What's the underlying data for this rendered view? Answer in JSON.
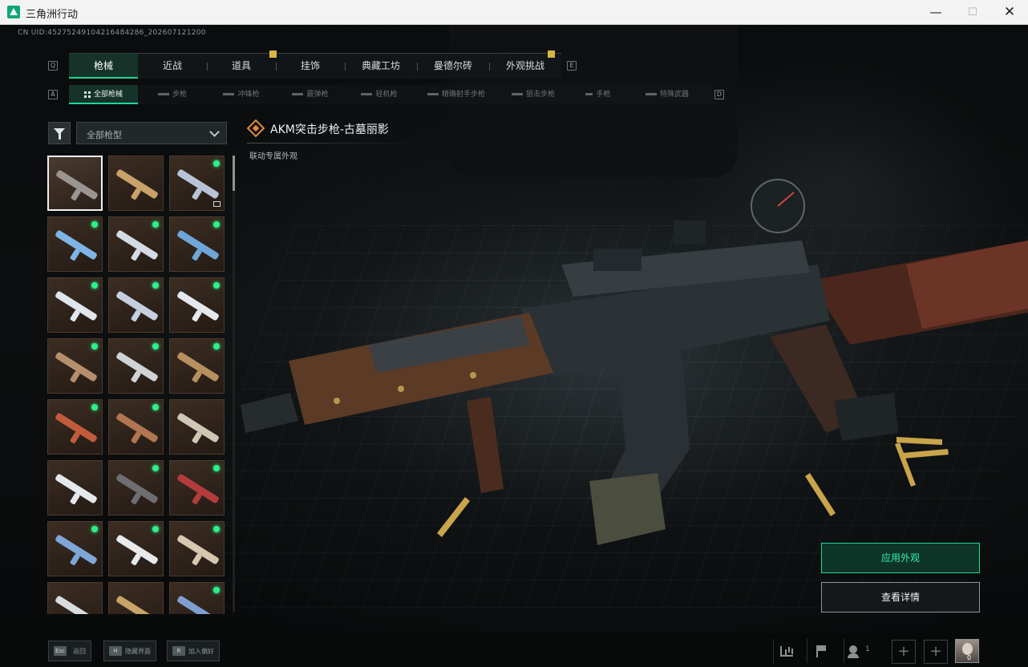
{
  "window": {
    "title": "三角洲行动"
  },
  "uid": "CN UID:452752491042164842­86_202607121200",
  "tabs": [
    {
      "label": "枪械",
      "active": true
    },
    {
      "label": "近战",
      "active": false
    },
    {
      "label": "道具",
      "active": false
    },
    {
      "label": "挂饰",
      "active": false
    },
    {
      "label": "典藏工坊",
      "active": false
    },
    {
      "label": "曼德尔砖",
      "active": false
    },
    {
      "label": "外观挑战",
      "active": false
    }
  ],
  "tab_keys": {
    "left": "Q",
    "right": "E"
  },
  "sub_tabs": [
    {
      "label": "全部枪械",
      "active": true
    },
    {
      "label": "步枪",
      "active": false
    },
    {
      "label": "冲锋枪",
      "active": false
    },
    {
      "label": "霰弹枪",
      "active": false
    },
    {
      "label": "轻机枪",
      "active": false
    },
    {
      "label": "精确射手步枪",
      "active": false
    },
    {
      "label": "狙击步枪",
      "active": false
    },
    {
      "label": "手枪",
      "active": false
    },
    {
      "label": "特殊武器",
      "active": false
    }
  ],
  "sub_keys": {
    "left": "A",
    "right": "D"
  },
  "filter": {
    "selected": "全部枪型"
  },
  "skins": [
    {
      "new": false,
      "selected": true,
      "tone": "#9a9590"
    },
    {
      "new": false,
      "tone": "#c9a26a"
    },
    {
      "new": true,
      "tone": "#b8c4d6",
      "mini_icon": true
    },
    {
      "new": true,
      "tone": "#7fb4e6"
    },
    {
      "new": true,
      "tone": "#d4dbe4"
    },
    {
      "new": true,
      "tone": "#6fa6d6"
    },
    {
      "new": true,
      "tone": "#dfe6ee"
    },
    {
      "new": true,
      "tone": "#c4cfe0"
    },
    {
      "new": true,
      "tone": "#e4e9ee"
    },
    {
      "new": true,
      "tone": "#b58e6c"
    },
    {
      "new": true,
      "tone": "#cfd3d6"
    },
    {
      "new": true,
      "tone": "#b89060"
    },
    {
      "new": true,
      "tone": "#c25a3c"
    },
    {
      "new": true,
      "tone": "#b27552"
    },
    {
      "new": false,
      "tone": "#cfc6b4"
    },
    {
      "new": false,
      "tone": "#e6e9ec"
    },
    {
      "new": true,
      "tone": "#6e6e72"
    },
    {
      "new": true,
      "tone": "#b23c3c"
    },
    {
      "new": true,
      "tone": "#7ea7d8"
    },
    {
      "new": true,
      "tone": "#e8eaec"
    },
    {
      "new": true,
      "tone": "#d6c7ae"
    },
    {
      "new": false,
      "tone": "#d9dcdf"
    },
    {
      "new": false,
      "tone": "#c8a468"
    },
    {
      "new": true,
      "tone": "#7f9fd0"
    }
  ],
  "weapon": {
    "name": "AKM突击步枪-古墓丽影",
    "tag": "联动专属外观",
    "icon": "diamond-emblem-icon",
    "accent": "#e08a3c"
  },
  "actions": {
    "apply": "应用外观",
    "details": "查看详情"
  },
  "accent_color": "#1ed69a",
  "bottom_hints": [
    {
      "key": "Esc",
      "label": "返回"
    },
    {
      "key": "H",
      "label": "隐藏界面"
    },
    {
      "key": "R",
      "label": "加入偏好"
    }
  ],
  "bottom_right": {
    "team_count": "1",
    "avatar_badge": "0",
    "plus": "+"
  },
  "window_controls": {
    "minimize": "—",
    "maximize": "☐",
    "close": "✕"
  }
}
